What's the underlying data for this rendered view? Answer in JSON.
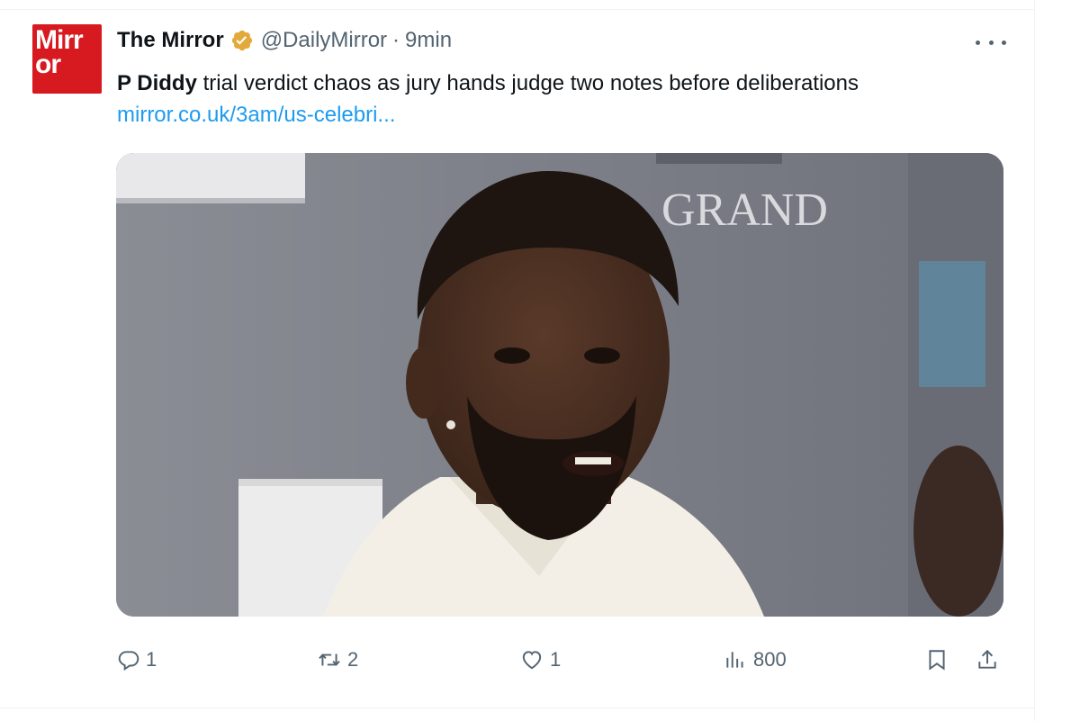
{
  "tweet": {
    "avatar_text": "Mirr\nor",
    "display_name": "The Mirror",
    "handle": "@DailyMirror",
    "separator": "·",
    "timestamp": "9min",
    "text_bold": "P Diddy",
    "text_body": " trial verdict chaos as jury hands judge two notes before deliberations ",
    "link_text": "mirror.co.uk/3am/us-celebri...",
    "media_sign_text": "GRAND"
  },
  "actions": {
    "reply_count": "1",
    "retweet_count": "2",
    "like_count": "1",
    "views_count": "800"
  },
  "icons": {
    "verified": "verified-badge-gold",
    "more": "more-horizontal-icon",
    "reply": "reply-icon",
    "retweet": "retweet-icon",
    "like": "heart-icon",
    "views": "views-bar-chart-icon",
    "bookmark": "bookmark-icon",
    "share": "share-icon"
  },
  "colors": {
    "link": "#1d9bf0",
    "secondary_text": "#536471",
    "brand_red": "#d71920",
    "verified_gold": "#e2a93b"
  }
}
